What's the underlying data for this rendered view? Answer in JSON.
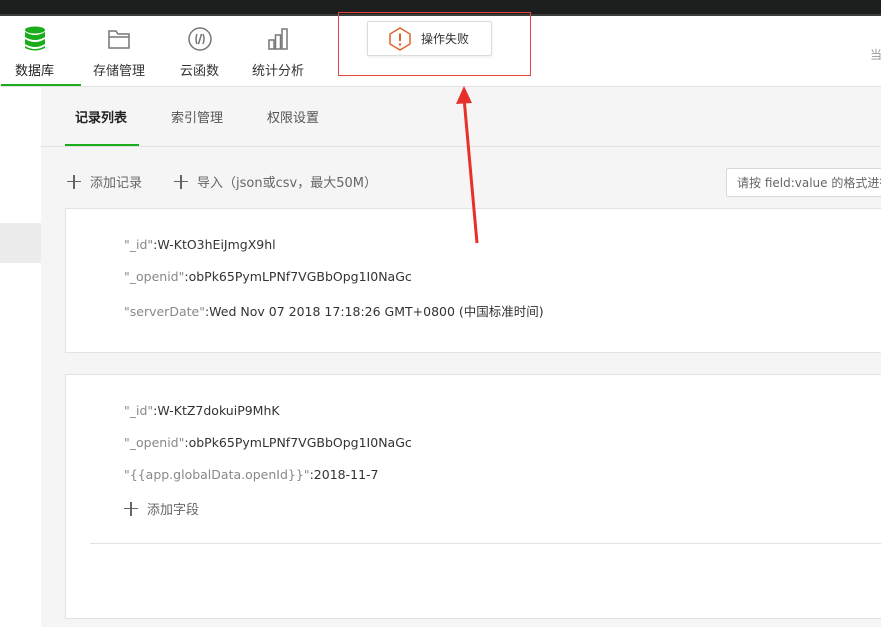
{
  "toolbar": {
    "items": [
      {
        "label": "数据库",
        "icon": "database-icon"
      },
      {
        "label": "存储管理",
        "icon": "folder-icon"
      },
      {
        "label": "云函数",
        "icon": "cloud-function-icon"
      },
      {
        "label": "统计分析",
        "icon": "bar-chart-icon"
      }
    ],
    "right_cut_text": "当"
  },
  "toast": {
    "text": "操作失败",
    "icon": "warning-icon",
    "accent": "#e0632b"
  },
  "tabs": [
    {
      "label": "记录列表"
    },
    {
      "label": "索引管理"
    },
    {
      "label": "权限设置"
    }
  ],
  "actions": {
    "add_record": "添加记录",
    "import": "导入（json或csv，最大50M）"
  },
  "search": {
    "placeholder": "请按 field:value 的格式进行"
  },
  "records": [
    {
      "fields": [
        {
          "key": "\"_id\"",
          "value": ":W-KtO3hEiJmgX9hl"
        },
        {
          "key": "\"_openid\"",
          "value": ":obPk65PymLPNf7VGBbOpg1I0NaGc"
        },
        {
          "key": "\"serverDate\"",
          "value": ":Wed Nov 07 2018 17:18:26 GMT+0800 (中国标准时间)"
        }
      ]
    },
    {
      "fields": [
        {
          "key": "\"_id\"",
          "value": ":W-KtZ7dokuiP9MhK"
        },
        {
          "key": "\"_openid\"",
          "value": ":obPk65PymLPNf7VGBbOpg1I0NaGc"
        },
        {
          "key": "\"{{app.globalData.openId}}\"",
          "value": ":2018-11-7"
        }
      ],
      "add_field": "添加字段"
    }
  ],
  "colors": {
    "accent": "#1aad19",
    "alert_red": "#e64340"
  }
}
